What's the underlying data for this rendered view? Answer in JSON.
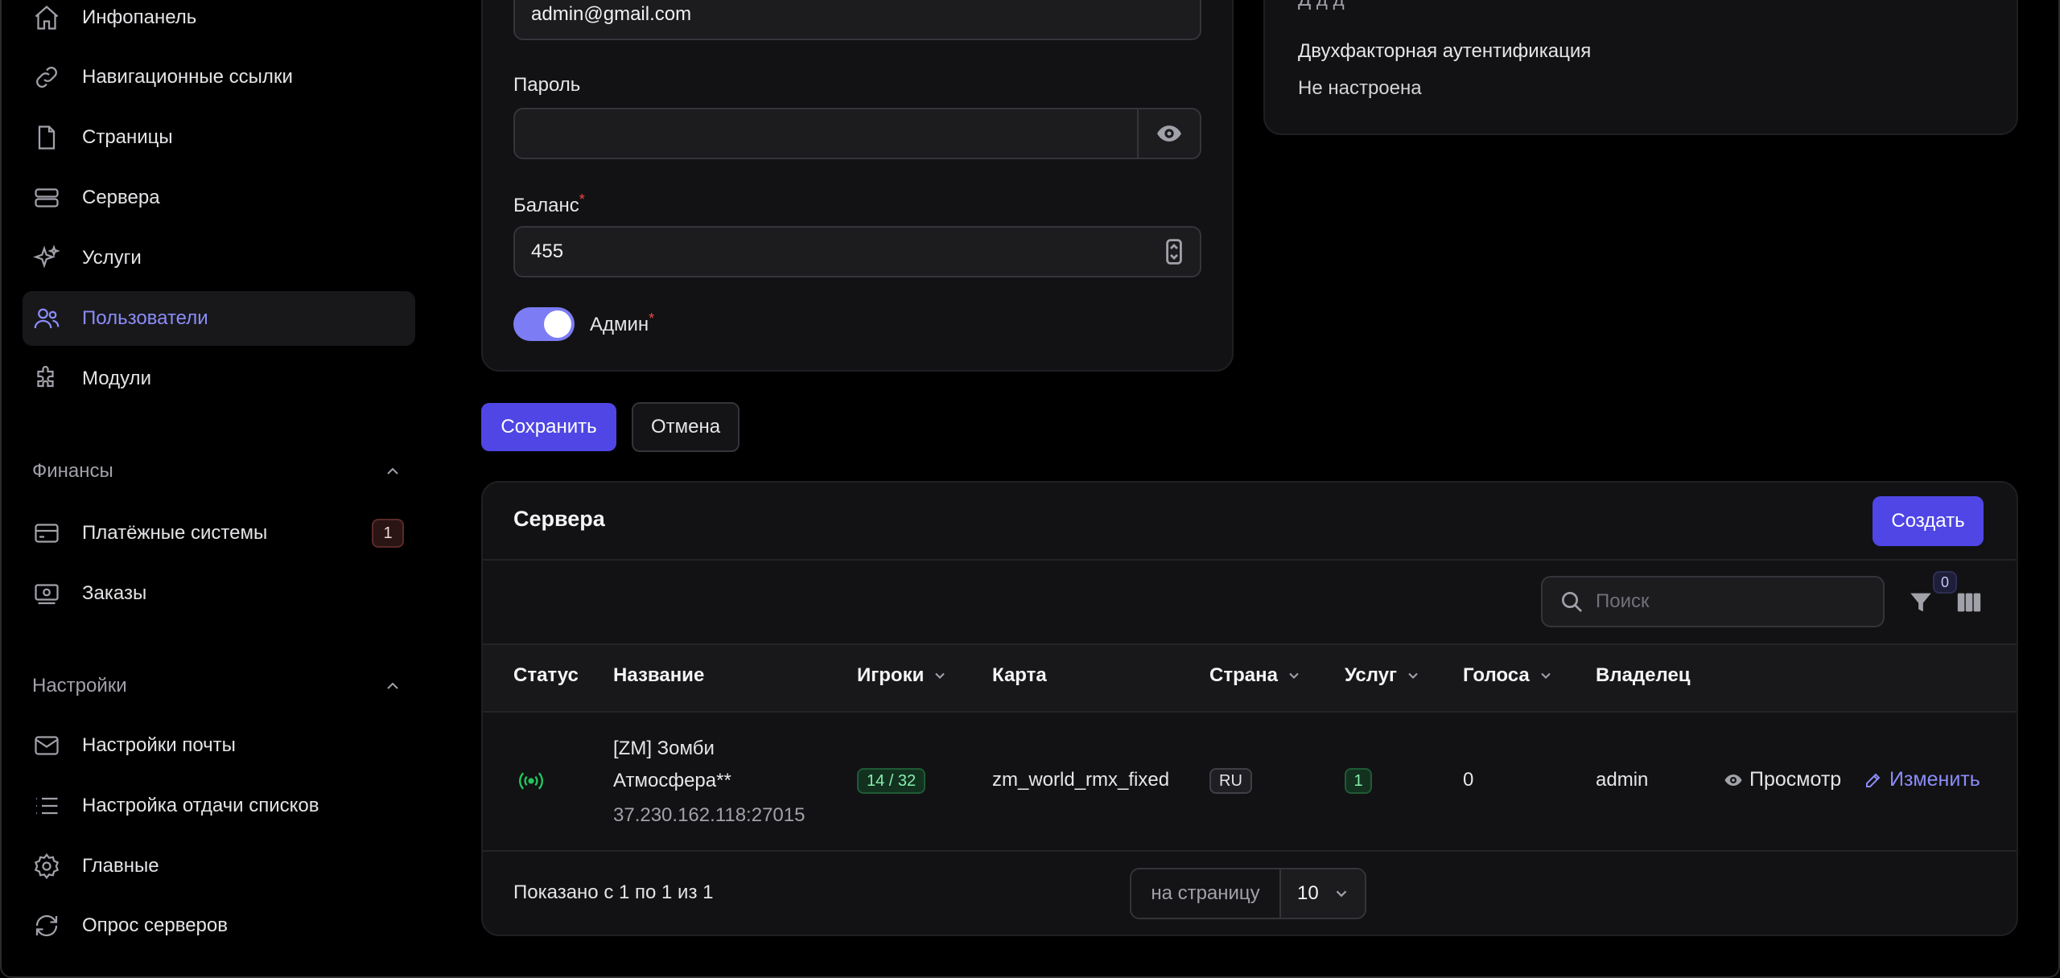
{
  "sidebar": {
    "items": [
      {
        "label": "Инфопанель",
        "icon": "home-icon"
      },
      {
        "label": "Навигационные ссылки",
        "icon": "link-icon"
      },
      {
        "label": "Страницы",
        "icon": "document-icon"
      },
      {
        "label": "Сервера",
        "icon": "server-icon"
      },
      {
        "label": "Услуги",
        "icon": "sparkles-icon"
      },
      {
        "label": "Пользователи",
        "icon": "users-icon",
        "active": true
      },
      {
        "label": "Модули",
        "icon": "puzzle-icon"
      }
    ],
    "groups": [
      {
        "title": "Финансы",
        "items": [
          {
            "label": "Платёжные системы",
            "icon": "credit-card-icon",
            "badge": "1"
          },
          {
            "label": "Заказы",
            "icon": "cash-icon"
          }
        ]
      },
      {
        "title": "Настройки",
        "items": [
          {
            "label": "Настройки почты",
            "icon": "envelope-icon"
          },
          {
            "label": "Настройка отдачи списков",
            "icon": "list-icon"
          },
          {
            "label": "Главные",
            "icon": "cog-icon"
          },
          {
            "label": "Опрос серверов",
            "icon": "refresh-icon"
          }
        ]
      }
    ]
  },
  "form": {
    "email_value": "admin@gmail.com",
    "password_label": "Пароль",
    "password_value": "",
    "balance_label": "Баланс",
    "balance_value": "455",
    "admin_label": "Админ",
    "admin_enabled": true,
    "required_mark": "*",
    "save_label": "Сохранить",
    "cancel_label": "Отмена"
  },
  "security": {
    "partial_text": "Д  д    д",
    "two_factor_title": "Двухфакторная аутентификация",
    "two_factor_value": "Не настроена"
  },
  "servers": {
    "title": "Сервера",
    "create_label": "Создать",
    "search_placeholder": "Поиск",
    "filter_count": "0",
    "columns": [
      "Статус",
      "Название",
      "Игроки",
      "Карта",
      "Страна",
      "Услуг",
      "Голоса",
      "Владелец"
    ],
    "rows": [
      {
        "status": "online",
        "name_line1": "[ZM] Зомби",
        "name_line2": "Атмосфера**",
        "address": "37.230.162.118:27015",
        "players": "14 / 32",
        "map": "zm_world_rmx_fixed",
        "country": "RU",
        "services": "1",
        "votes": "0",
        "owner": "admin"
      }
    ],
    "view_label": "Просмотр",
    "edit_label": "Изменить",
    "pagination_summary": "Показано с 1 по 1 из 1",
    "per_page_label": "на страницу",
    "per_page_value": "10"
  },
  "colors": {
    "accent": "#4f46e5",
    "active_nav": "#8b8cf8",
    "online": "#22c55e"
  }
}
